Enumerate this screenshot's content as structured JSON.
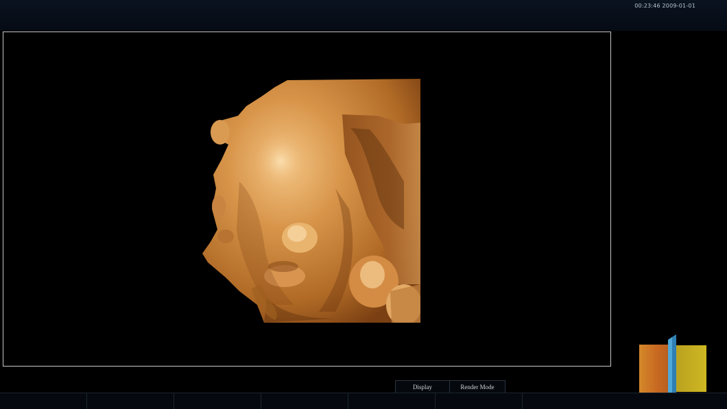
{
  "header": {
    "datetime": "00:23:46 2009-01-01"
  },
  "viewport": {
    "content": "3d-fetal-face-render"
  },
  "tabs": [
    {
      "label": "Display"
    },
    {
      "label": "Render Mode"
    }
  ],
  "colors": {
    "render_base": "#c07a30",
    "render_highlight": "#f0c07a",
    "render_shadow": "#5a2e0a",
    "frame_border": "#c8c8c8",
    "orientation_warm": "#d4882a",
    "orientation_yellow": "#c9b021",
    "orientation_plane": "#3a8fc0"
  }
}
